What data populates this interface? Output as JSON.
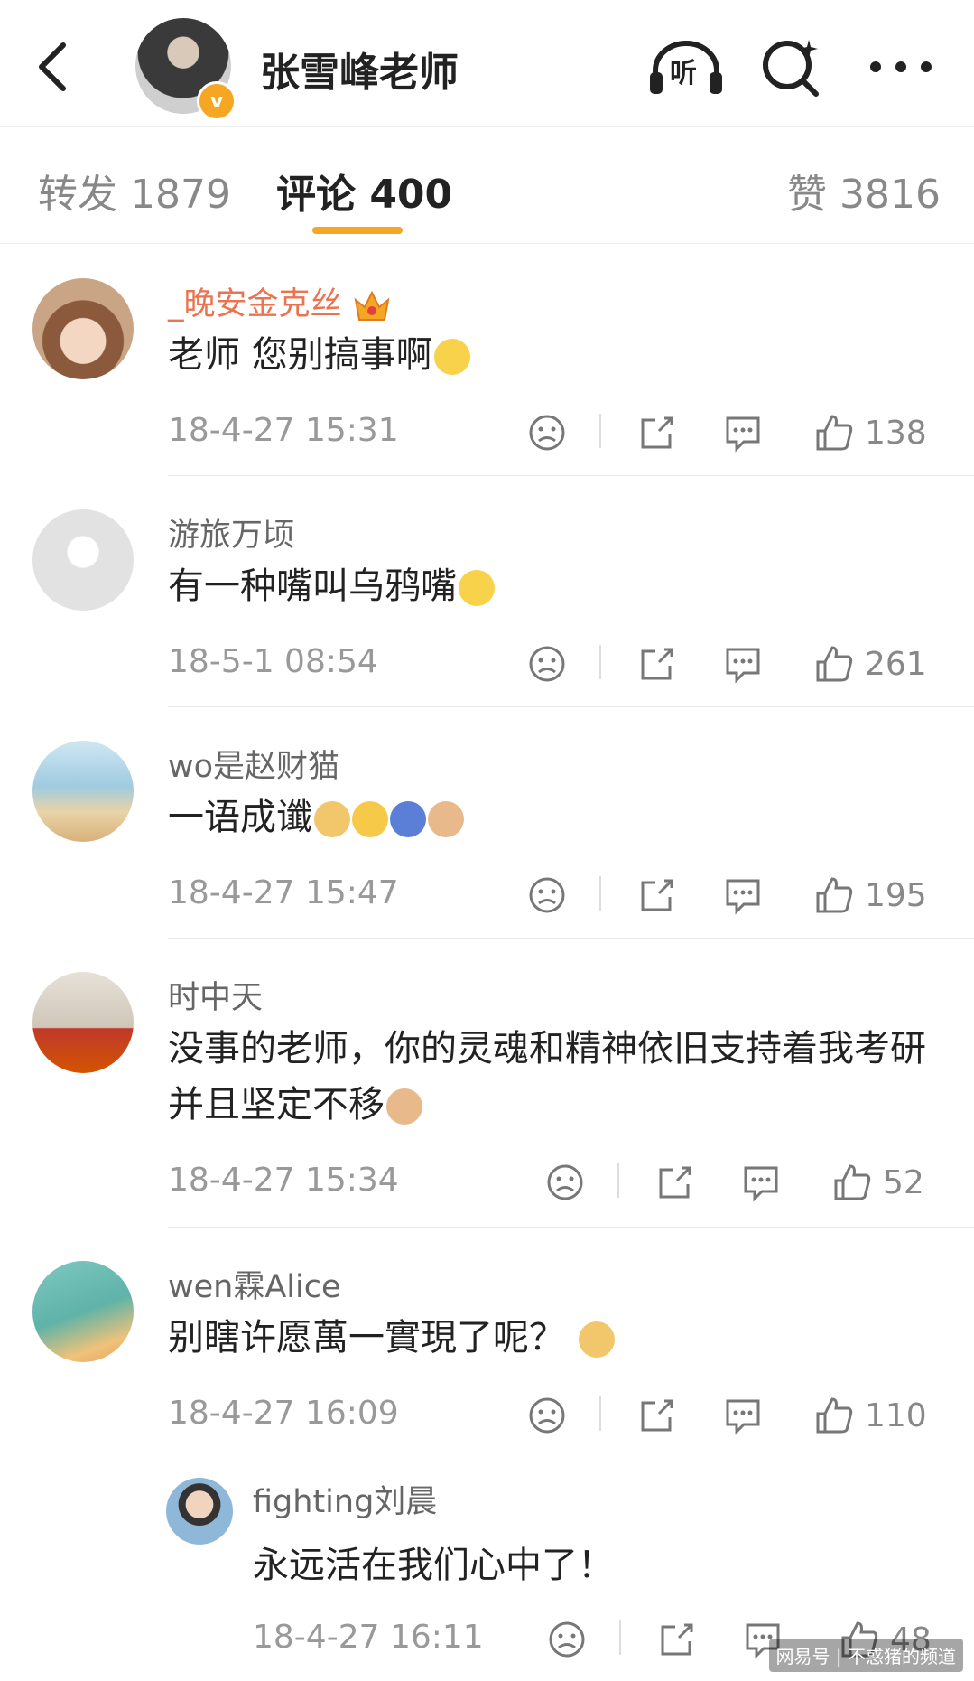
{
  "header": {
    "title": "张雪峰老师",
    "listen_label": "听",
    "badge": "v"
  },
  "tabs": [
    {
      "label": "转发 1879"
    },
    {
      "label": "评论 400"
    },
    {
      "label": "赞 3816"
    }
  ],
  "comments": [
    {
      "user": "_晚安金克丝",
      "text": "老师  您别搞事啊",
      "time": "18-4-27 15:31",
      "likes": "138"
    },
    {
      "user": "游旅万顷",
      "text": "有一种嘴叫乌鸦嘴",
      "time": "18-5-1 08:54",
      "likes": "261"
    },
    {
      "user": "wo是赵财猫",
      "text": "一语成谶",
      "time": "18-4-27 15:47",
      "likes": "195"
    },
    {
      "user": "时中天",
      "text": "没事的老师，你的灵魂和精神依旧支持着我考研并且坚定不移",
      "time": "18-4-27 15:34",
      "likes": "52"
    },
    {
      "user": "wen霖Alice",
      "text": "别瞎许愿萬一實現了呢？",
      "time": "18-4-27 16:09",
      "likes": "110"
    }
  ],
  "reply": {
    "user": "fighting刘晨",
    "text": "永远活在我们心中了！",
    "time": "18-4-27 16:11",
    "likes": "48"
  },
  "watermark": "网易号 | 不惑猪的频道",
  "colors": {
    "accent": "#f5a623",
    "vip_name": "#eb7350"
  }
}
